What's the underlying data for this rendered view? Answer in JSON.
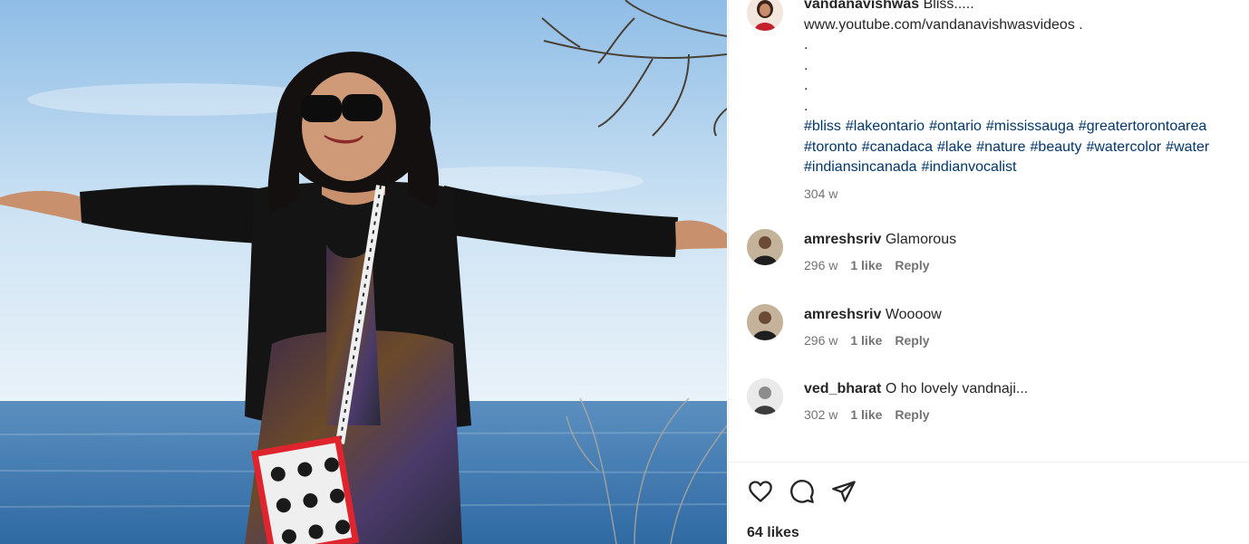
{
  "post": {
    "author": "vandanavishwas",
    "caption_text": "Bliss.....",
    "caption_link": "www.youtube.com/vandanavishwasvideos .",
    "caption_dots": [
      ".",
      ".",
      ".",
      "."
    ],
    "hashtags": [
      "#bliss",
      "#lakeontario",
      "#ontario",
      "#mississauga",
      "#greatertorontoarea",
      "#toronto",
      "#canadaca",
      "#lake",
      "#nature",
      "#beauty",
      "#watercolor",
      "#water",
      "#indiansincanada",
      "#indianvocalist"
    ],
    "time": "304 w"
  },
  "comments": [
    {
      "user": "amreshsriv",
      "text": "Glamorous",
      "time": "296 w",
      "likes": "1 like",
      "reply": "Reply"
    },
    {
      "user": "amreshsriv",
      "text": "Woooow",
      "time": "296 w",
      "likes": "1 like",
      "reply": "Reply"
    },
    {
      "user": "ved_bharat",
      "text": "O ho lovely vandnaji...",
      "time": "302 w",
      "likes": "1 like",
      "reply": "Reply"
    }
  ],
  "actions": {
    "icons": [
      "heart-icon",
      "comment-icon",
      "share-icon"
    ],
    "likes_count": "64 likes"
  },
  "colors": {
    "hashtag": "#00376b",
    "muted": "#737373",
    "text": "#262626"
  }
}
